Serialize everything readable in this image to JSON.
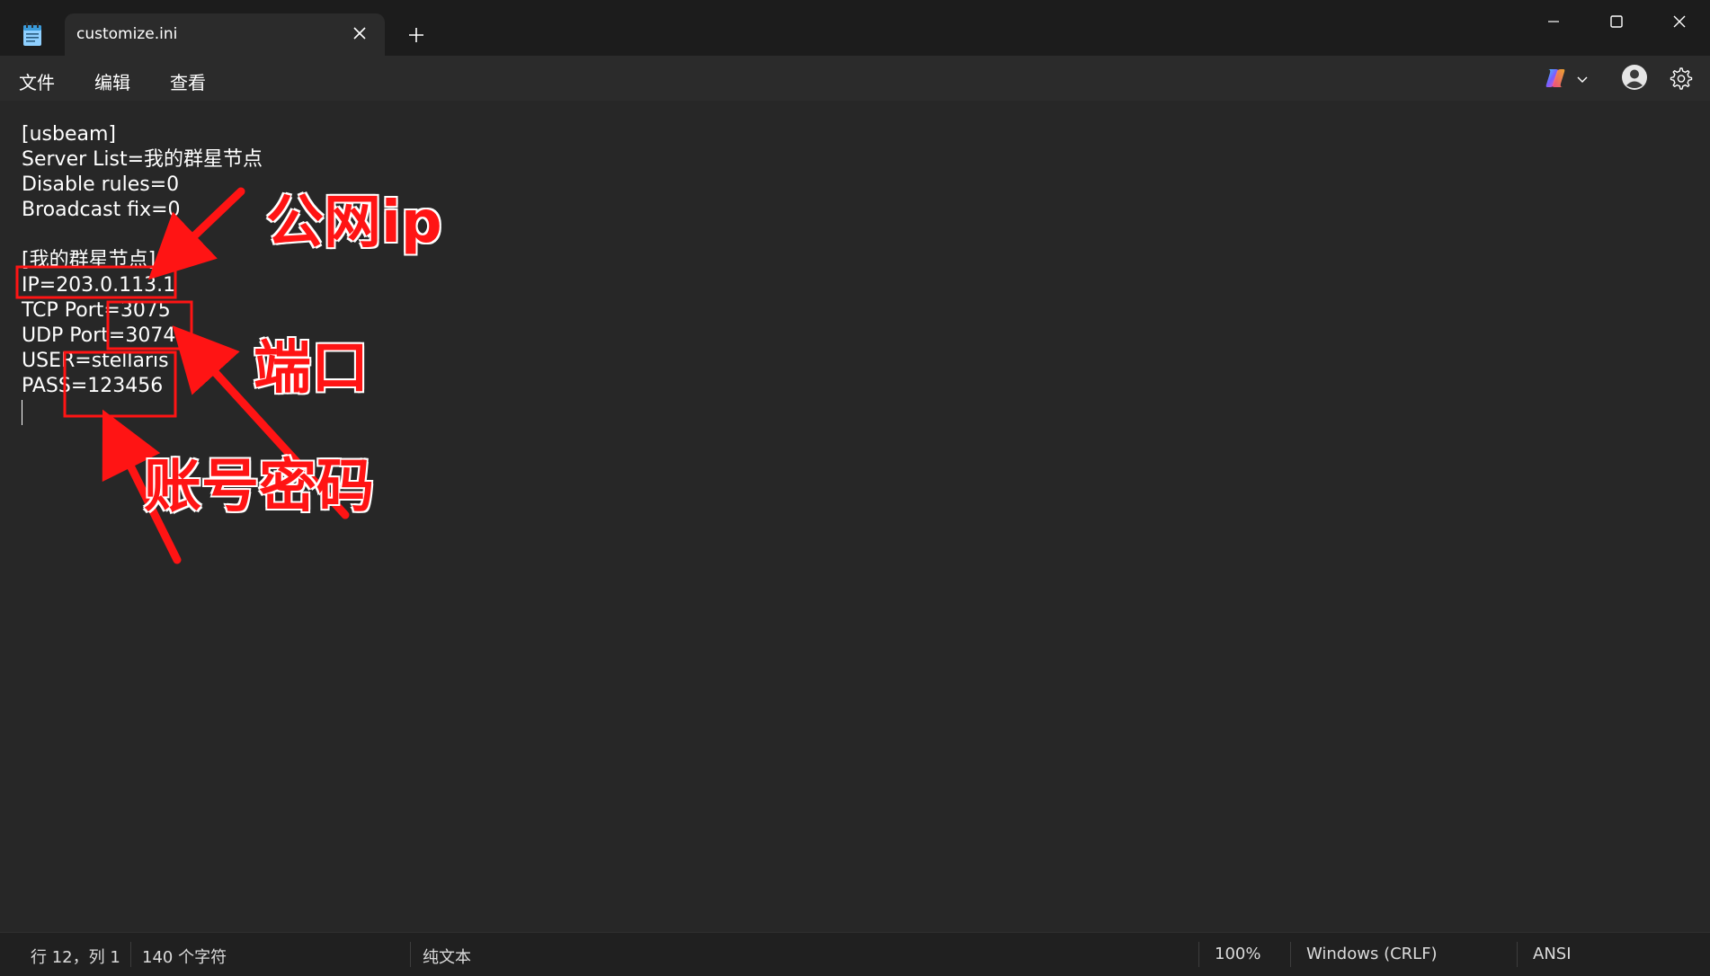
{
  "titlebar": {
    "tab_title": "customize.ini"
  },
  "menubar": {
    "file": "文件",
    "edit": "编辑",
    "view": "查看"
  },
  "editor": {
    "lines": [
      "[usbeam]",
      "Server List=我的群星节点",
      "Disable rules=0",
      "Broadcast fix=0",
      "",
      "[我的群星节点]",
      "IP=203.0.113.1",
      "TCP Port=3075",
      "UDP Port=3074",
      "USER=stellaris",
      "PASS=123456",
      ""
    ]
  },
  "annotations": {
    "ip_label": "公网ip",
    "port_label": "端口",
    "account_label": "账号密码",
    "color": "#ff1414"
  },
  "statusbar": {
    "position": "行 12，列 1",
    "char_count": "140 个字符",
    "format": "纯文本",
    "zoom": "100%",
    "line_ending": "Windows (CRLF)",
    "encoding": "ANSI"
  },
  "icons": {
    "app": "notepad-icon",
    "close": "close-icon",
    "new_tab": "plus-icon",
    "minimize": "minimize-icon",
    "maximize": "maximize-icon",
    "window_close": "close-icon",
    "copilot": "copilot-icon",
    "chevron": "chevron-down-icon",
    "account": "avatar-icon",
    "settings": "gear-icon"
  }
}
